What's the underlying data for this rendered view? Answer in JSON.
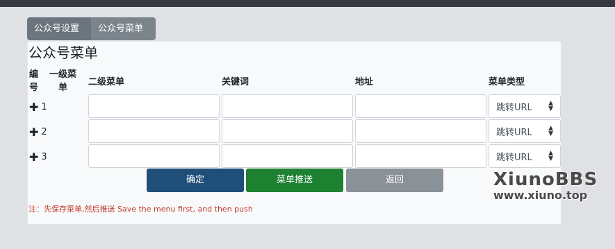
{
  "tabs": [
    {
      "label": "公众号设置"
    },
    {
      "label": "公众号菜单"
    }
  ],
  "panel": {
    "title": "公众号菜单",
    "headers": {
      "number": [
        "编",
        "号"
      ],
      "level1": [
        "一级菜",
        "单"
      ],
      "level2": "二级菜单",
      "keyword": "关键词",
      "url": "地址",
      "menu_type": "菜单类型"
    },
    "rows": [
      {
        "number": "1",
        "level2": "",
        "keyword": "",
        "url": "",
        "type": "跳转URL"
      },
      {
        "number": "2",
        "level2": "",
        "keyword": "",
        "url": "",
        "type": "跳转URL"
      },
      {
        "number": "3",
        "level2": "",
        "keyword": "",
        "url": "",
        "type": "跳转URL"
      }
    ],
    "buttons": {
      "confirm": "确定",
      "push": "菜单推送",
      "back": "返回"
    },
    "note": "注：先保存菜单,然后推送 Save the menu first, and then push"
  },
  "watermark": {
    "brand": "XiunoBBS",
    "url": "www.xiuno.top"
  },
  "icons": {
    "add": "plus-icon",
    "select": "updown-caret-icon"
  },
  "colors": {
    "confirm": "#1f4e79",
    "push": "#1e8132",
    "back": "#8a9197",
    "note": "#c0392b"
  }
}
